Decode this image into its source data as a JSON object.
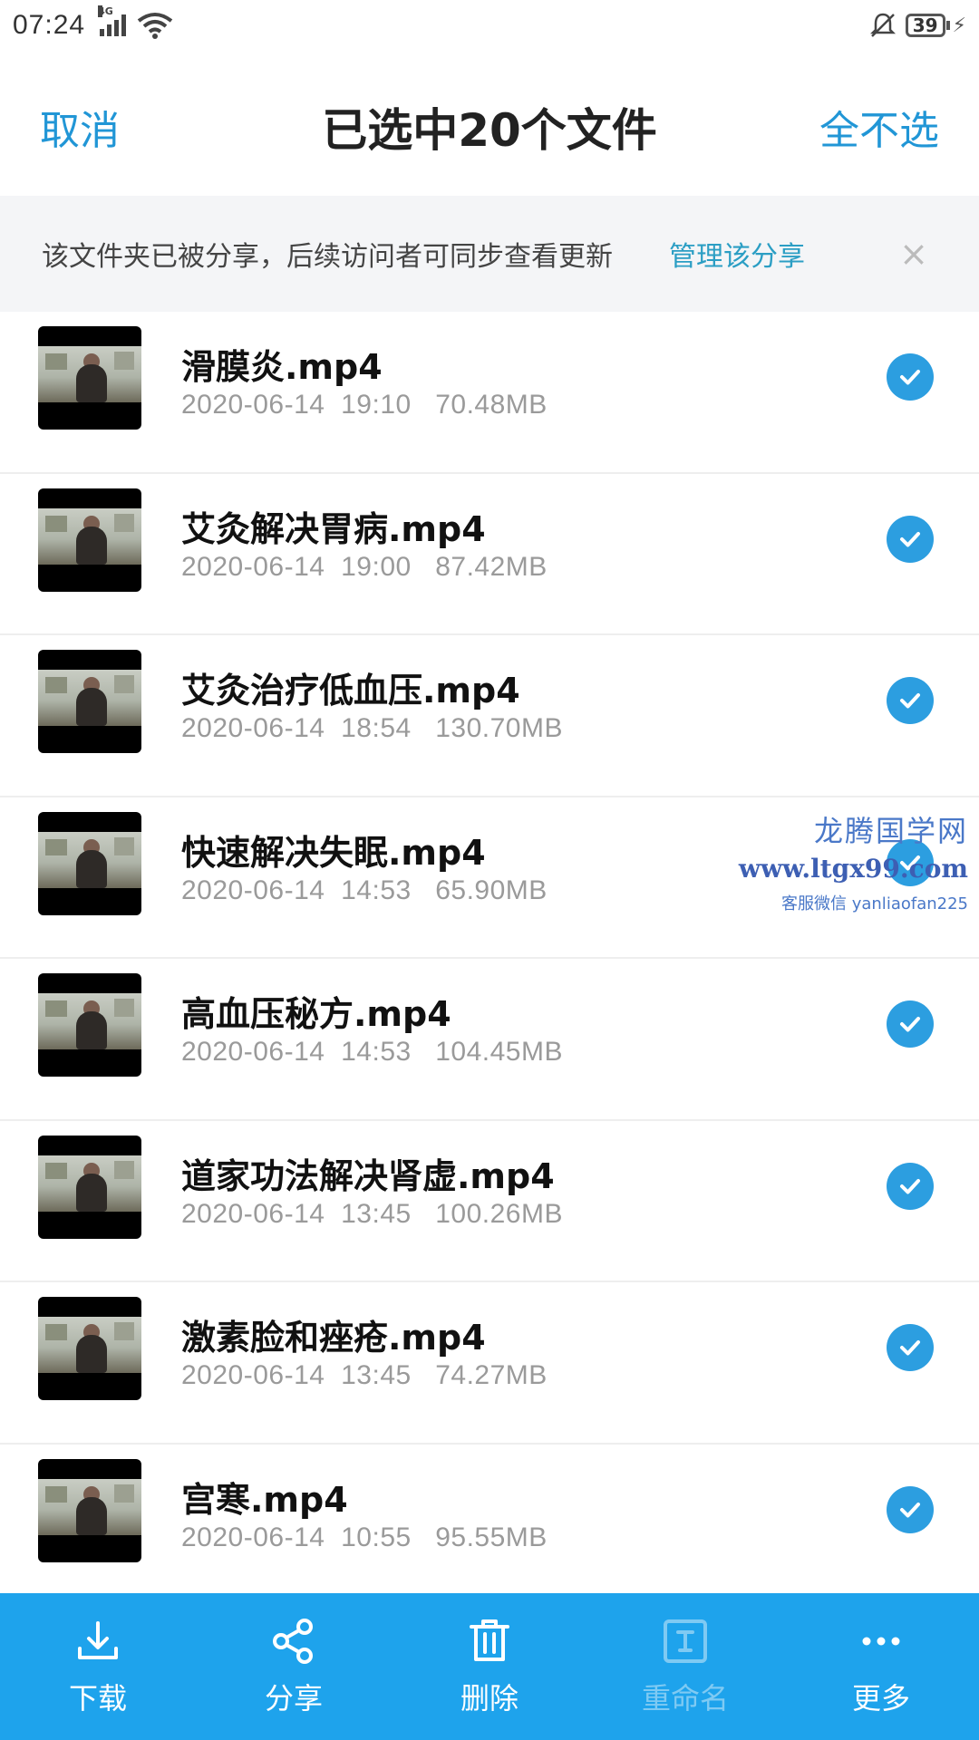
{
  "status_bar": {
    "time": "07:24",
    "network": "4G",
    "battery": "39"
  },
  "header": {
    "cancel": "取消",
    "title": "已选中20个文件",
    "deselect_all": "全不选"
  },
  "banner": {
    "text": "该文件夹已被分享，后续访问者可同步查看更新",
    "manage": "管理该分享",
    "close": "×"
  },
  "files": [
    {
      "name": "滑膜炎.mp4",
      "date": "2020-06-14  19:10",
      "size": "70.48MB"
    },
    {
      "name": "艾灸解决胃病.mp4",
      "date": "2020-06-14  19:00",
      "size": "87.42MB"
    },
    {
      "name": "艾灸治疗低血压.mp4",
      "date": "2020-06-14  18:54",
      "size": "130.70MB"
    },
    {
      "name": "快速解决失眠.mp4",
      "date": "2020-06-14  14:53",
      "size": "65.90MB"
    },
    {
      "name": "高血压秘方.mp4",
      "date": "2020-06-14  14:53",
      "size": "104.45MB"
    },
    {
      "name": "道家功法解决肾虚.mp4",
      "date": "2020-06-14  13:45",
      "size": "100.26MB"
    },
    {
      "name": "激素脸和痤疮.mp4",
      "date": "2020-06-14  13:45",
      "size": "74.27MB"
    },
    {
      "name": "宫寒.mp4",
      "date": "2020-06-14  10:55",
      "size": "95.55MB"
    }
  ],
  "watermark": {
    "title": "龙腾国学网",
    "url": "www.ltgx99.com",
    "contact": "客服微信 yanliaofan225"
  },
  "toolbar": {
    "download": "下载",
    "share": "分享",
    "delete": "删除",
    "rename": "重命名",
    "more": "更多"
  },
  "colors": {
    "accent": "#2196d6",
    "toolbar": "#1ea3ec",
    "check": "#2c9ee0"
  }
}
